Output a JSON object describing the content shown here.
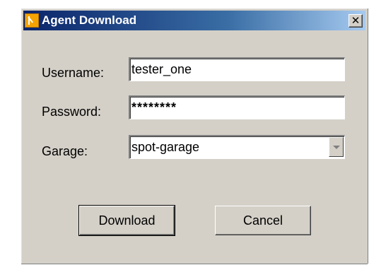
{
  "window": {
    "title": "Agent Download",
    "icon": "app-logo-icon",
    "close_symbol": "✕"
  },
  "form": {
    "username_label": "Username:",
    "username_value": "tester_one",
    "password_label": "Password:",
    "password_value": "********",
    "garage_label": "Garage:",
    "garage_value": "spot-garage"
  },
  "buttons": {
    "download_label": "Download",
    "cancel_label": "Cancel"
  },
  "colors": {
    "titlebar_start": "#0a246a",
    "titlebar_end": "#a6caf0",
    "dialog_bg": "#d4d0c8",
    "app_icon": "#f5a300"
  }
}
